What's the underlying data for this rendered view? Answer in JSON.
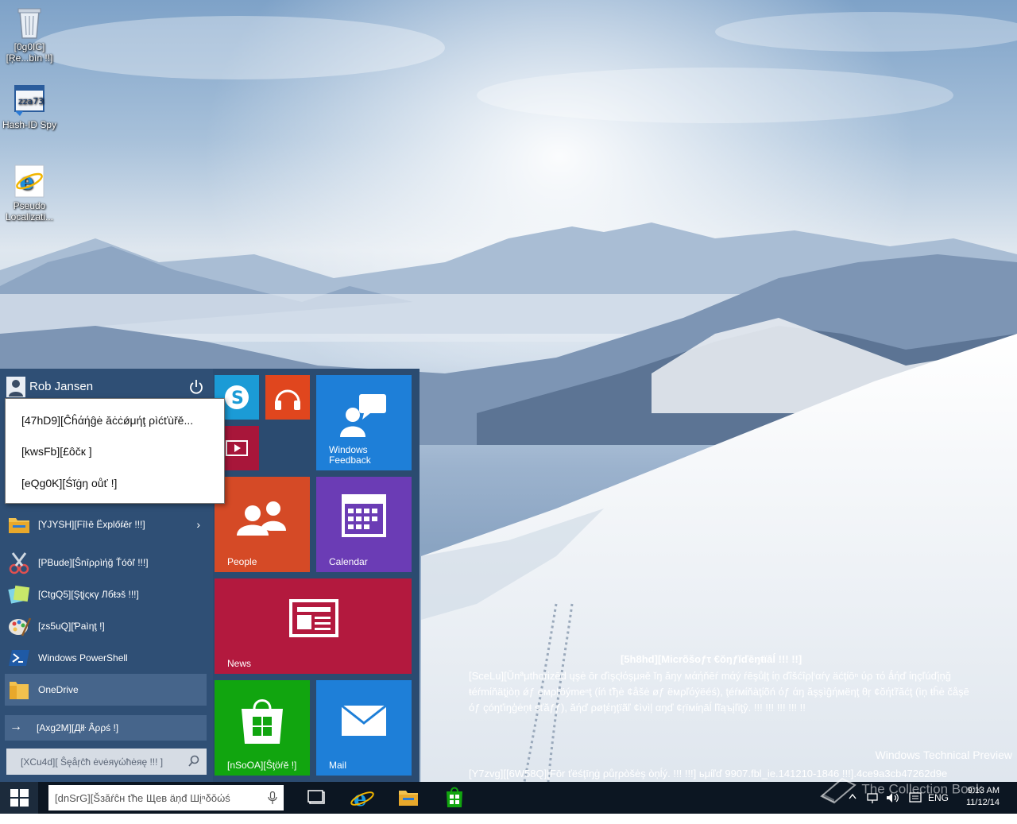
{
  "desktop_icons": [
    {
      "label": "[0g0IC][Ŗe...bìn !!]",
      "icon": "recycle-bin-icon"
    },
    {
      "label": "Hash-ID Spy",
      "icon": "hash-id-spy-icon"
    },
    {
      "label": "Pseudo Localizati...",
      "icon": "internet-explorer-icon"
    }
  ],
  "start_menu": {
    "user_name": "Rob Jansen",
    "user_context_menu": [
      "[47hD9][Ĉĥάήĝė ăċċǿμήţ ρìćťùřě...",
      "[kwsFb][£ôčк ]",
      "[eQg0K][Śĭġŋ οůť !]"
    ],
    "apps": [
      {
        "label": "[YJYSH][Fîŀē Ëxplőŕ̵ēr !!!]",
        "icon": "file-explorer-icon",
        "has_submenu": true
      },
      {
        "label": "[PBude][Ŝnîρρìήğ Ťóôľ !!!]",
        "icon": "snipping-tool-icon"
      },
      {
        "label": "[CtgQ5][Şţįςĸγ Лбŧэš !!!]",
        "icon": "sticky-notes-icon"
      },
      {
        "label": "[zs5uQ][Ƥaìηţ !]",
        "icon": "paint-icon"
      },
      {
        "label": "Windows PowerShell",
        "icon": "powershell-icon"
      },
      {
        "label": "OneDrive",
        "icon": "onedrive-icon",
        "highlighted": true
      }
    ],
    "all_apps_label": "[Axg2M][Дłŀ Âρρś !]",
    "search_placeholder": "[XCu4d][ Ŝęåŗĉћ ėνėяγώћėяę !!! ]",
    "tiles": {
      "windows_feedback": "Windows Feedback",
      "people": "People",
      "calendar": "Calendar",
      "news": "News",
      "store": "[nSoOA][Ŝţöŕĕ !]",
      "mail": "Mail"
    },
    "tile_colors": {
      "skype": "#1b9bd6",
      "music": "#e0461e",
      "video": "#a8163a",
      "windows_feedback": "#1e7fd8",
      "people": "#d54a26",
      "calendar": "#6b3cb5",
      "news": "#b3193e",
      "store": "#11a50f",
      "mail": "#1e7fd8"
    }
  },
  "watermark": {
    "title": "[5h8hd][Micrõšoƒτ €ŏŋƒĭďēŋŧïāĺ !!! !!]",
    "body": "[SceLu][Ŭnªμthorizēd ųşė ōr ďìşςłόşμяě ĭŋ ăŋγ мάήňēŕ mάý ŕēşůļţ ίņ ďîšćîρļⁱαŕγ äćţίōⁿ ύρ τό ǻήď ίηçľúďįņğ ŧéŕmίňäţįòņ ǿƒ емρŀöýmeⁿţ (ίń ťђė ¢åšė øƒ ёмρľόýëéś), ţéŕмίňàţίõń όƒ άŋ ăşşìĝήмёηţ θŗ ¢ŏήťřăćţ (ìņ ŧĥė čåşē όƒ çóŋťіŋģėņŧ ѕťăƒƒ), ăήď ρøţέŋţïãľ ¢ìνìļ αŋď ¢ŗїмίηāĺ ľĩąъįľіţŷ. !!! !!! !!! !!! !!",
    "edition": "Windows Technical Preview",
    "build": "[Y7zvg][[6W58Q][Fōr ťёśţīŋġ ρůŗρòšėş òņĺý. !!! !!!] ьμίľď 9907.fbl_ie.141210-1846 !!!].4ce9a3cb47262d9e",
    "book_watermark": "The Collection Book"
  },
  "taskbar": {
    "search_placeholder": "[dnSrG][Šзăŕĉн ťће Щев äņđ Шįⁿδŏώś",
    "pinned": [
      "task-view-icon",
      "internet-explorer-icon",
      "file-explorer-icon",
      "store-icon"
    ],
    "language": "ENG",
    "time": "9:13 AM",
    "date": "11/12/14"
  }
}
